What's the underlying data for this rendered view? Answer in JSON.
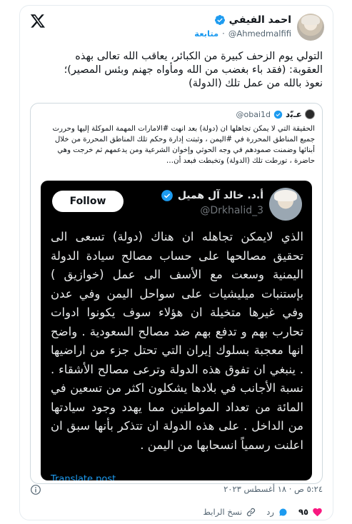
{
  "author": {
    "name": "احمد الفيفي",
    "handle": "@Ahmedmalfifi",
    "follow_label": "متابعة"
  },
  "tweet_text": "التولي يوم الزحف كبيرة من الكبائر، يعاقب الله تعالى بهذه العقوبة: (فقد باء بغضب من الله ومأواه جهنم وبئس المصير)؛ نعوذ بالله من عمل تلك (الدولة)",
  "quoted": {
    "name": "عـﺑّد",
    "handle": "@obai1d",
    "text": "الحقيقة التي لا يمكن تجاهلها ان (دولة) بعد انهت #الامارات المهمة الموكلة إليها وحررت جميع المناطق المحررة في #اليمن ، وثبتت إدارة وحكم تلك المناطق المحررة من خلال أبنائها وضمنت صمودهم في وجه الحوثي وإخوان الشرعية ومن يدعمهم ثم خرجت وهي حاضرة ، تورطت تلك (الدولة) وتخبطت فبعد أن…"
  },
  "screenshot": {
    "follow_label": "Follow",
    "name": "أ.د. خالد آل هميل",
    "handle": "@Drkhalid_3",
    "text": "الذي لايمكن تجاهله ان هناك (دولة) تسعى الى تحقيق مصالحها على حساب مصالح سيادة الدولة اليمنية وسعت مع الأسف الى عمل (خوازيق ) بإستنبات ميليشيات على سواحل اليمن وفي عدن وفي غيرها متخيلة ان هؤلاء سوف يكونوا ادوات تحارب بهم و تدفع بهم ضد مصالح السعودية . واضح انها معجبة بسلوك إيران التي تحتل جزء من اراضيها . ينبغي ان تفوق هذه الدولة وترعى مصالح الأشقاء . نسبة الأجانب في بلادها يشكلون اكثر من تسعين في المائة من تعداد المواطنين مما يهدد وجود سيادتها من الداخل . على هذه الدولة ان تتذكر بأنها سبق ان اعلنت رسمياً انسحابها من اليمن .",
    "translate_label": "Translate post"
  },
  "timestamp": "٥:٢٤ ص · ١٨ أغسطس ٢٠٢٣",
  "actions": {
    "likes": "٩٥",
    "reply_label": "رد",
    "copy_link_label": "نسخ الرابط"
  },
  "colors": {
    "accent": "#1d9bf0",
    "like": "#f91880",
    "text": "#0f1419",
    "muted": "#536471"
  },
  "icons": [
    "x-logo-icon",
    "verified-badge-icon",
    "info-icon",
    "heart-icon",
    "reply-icon",
    "link-icon"
  ]
}
